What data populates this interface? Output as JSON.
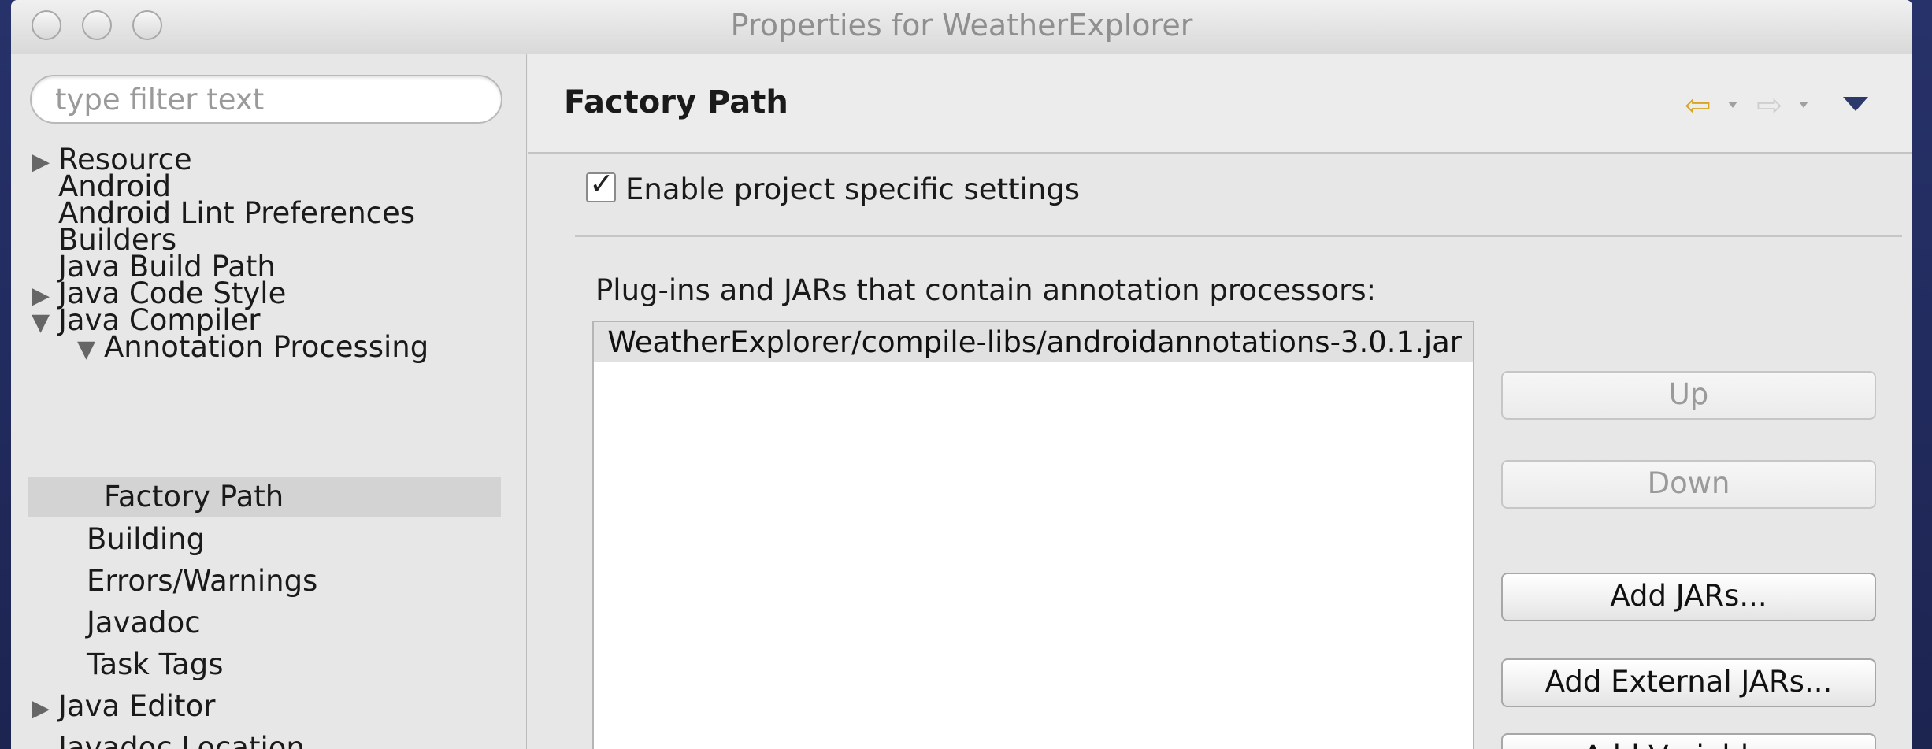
{
  "window": {
    "title": "Properties for WeatherExplorer"
  },
  "sidebar": {
    "filter_placeholder": "type filter text",
    "items": [
      {
        "label": "Resource",
        "arrow": "▶"
      },
      {
        "label": "Android",
        "arrow": ""
      },
      {
        "label": "Android Lint Preferences",
        "arrow": ""
      },
      {
        "label": "Builders",
        "arrow": ""
      },
      {
        "label": "Java Build Path",
        "arrow": ""
      },
      {
        "label": "Java Code Style",
        "arrow": "▶"
      },
      {
        "label": "Java Compiler",
        "arrow": "▼"
      },
      {
        "label": "Annotation Processing",
        "arrow": "▼"
      },
      {
        "label": "Factory Path",
        "arrow": ""
      },
      {
        "label": "Building",
        "arrow": ""
      },
      {
        "label": "Errors/Warnings",
        "arrow": ""
      },
      {
        "label": "Javadoc",
        "arrow": ""
      },
      {
        "label": "Task Tags",
        "arrow": ""
      },
      {
        "label": "Java Editor",
        "arrow": "▶"
      },
      {
        "label": "Javadoc Location",
        "arrow": ""
      }
    ]
  },
  "main": {
    "title": "Factory Path",
    "nav": {
      "back_icon": "⇦",
      "forward_icon": "⇨"
    },
    "enable_checkbox": {
      "label": "Enable project specific settings",
      "checked": true,
      "mark": "✓"
    },
    "list_label": "Plug-ins and JARs that contain annotation processors:",
    "jar_entries": [
      "WeatherExplorer/compile-libs/androidannotations-3.0.1.jar"
    ],
    "buttons": {
      "up": "Up",
      "down": "Down",
      "add_jars": "Add JARs...",
      "add_external_jars": "Add External JARs...",
      "add_variable": "Add Variable..."
    }
  }
}
